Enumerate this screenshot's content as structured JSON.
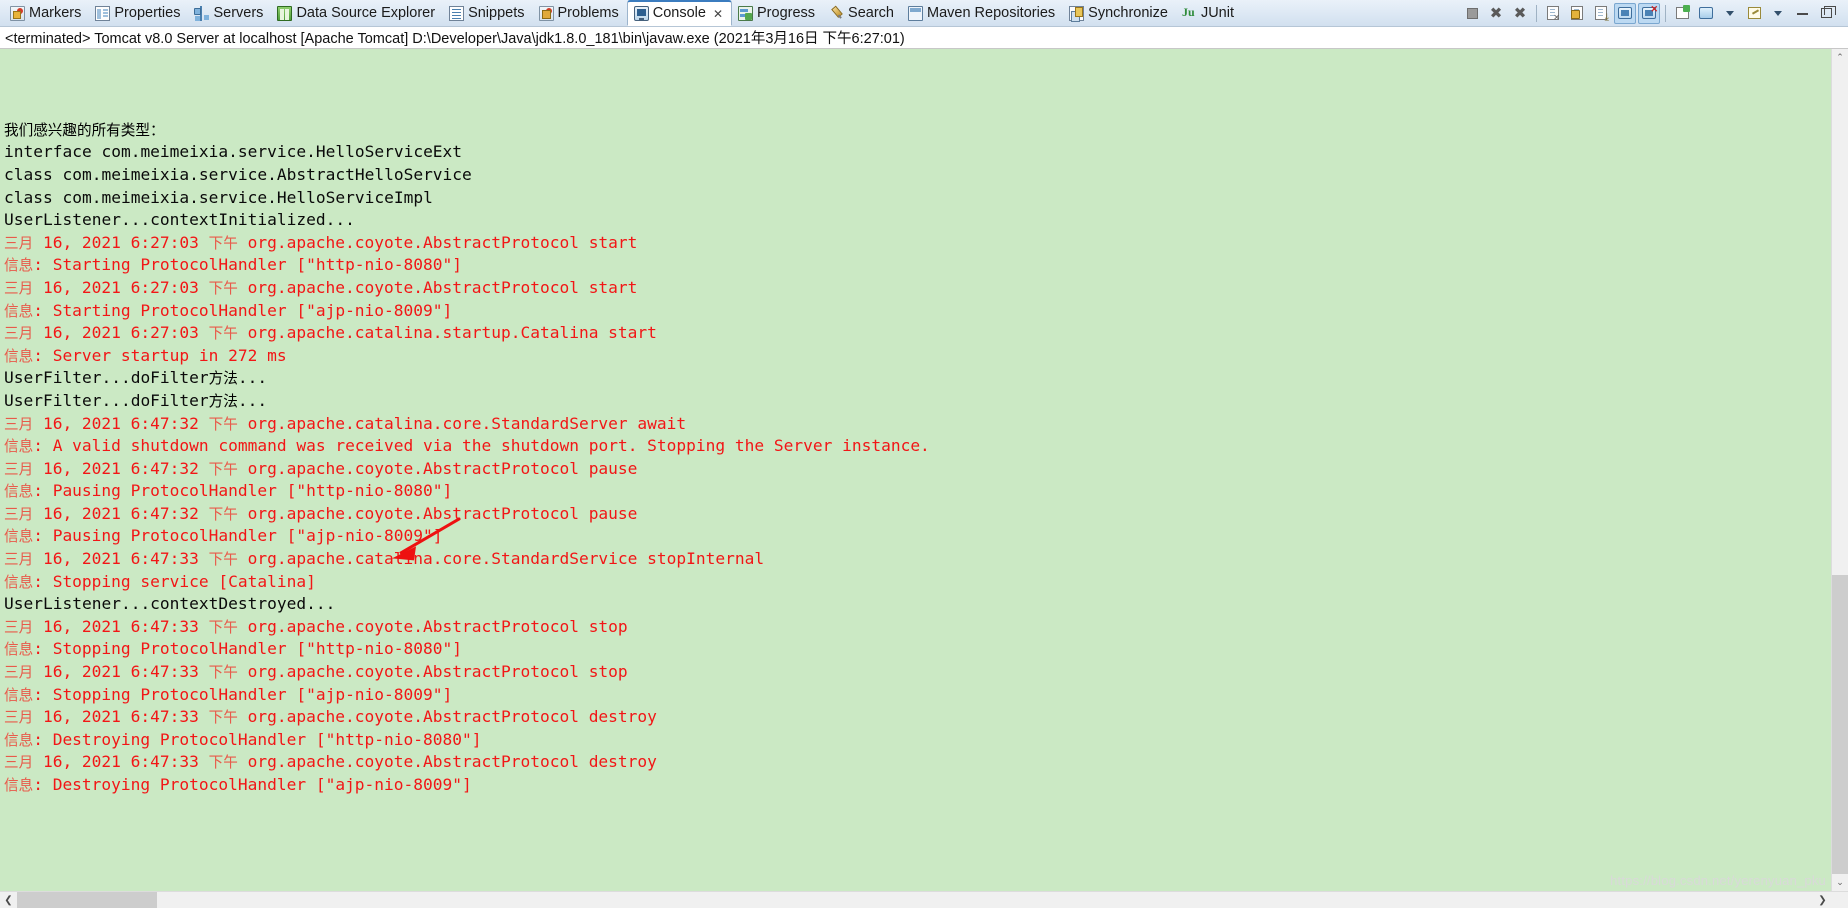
{
  "tabbar": {
    "tabs": [
      {
        "label": "Markers",
        "icon": "markers-icon",
        "active": false
      },
      {
        "label": "Properties",
        "icon": "properties-icon",
        "active": false
      },
      {
        "label": "Servers",
        "icon": "servers-icon",
        "active": false
      },
      {
        "label": "Data Source Explorer",
        "icon": "data-source-explorer-icon",
        "active": false
      },
      {
        "label": "Snippets",
        "icon": "snippets-icon",
        "active": false
      },
      {
        "label": "Problems",
        "icon": "problems-icon",
        "active": false
      },
      {
        "label": "Console",
        "icon": "console-icon",
        "active": true,
        "close": "✕"
      },
      {
        "label": "Progress",
        "icon": "progress-icon",
        "active": false
      },
      {
        "label": "Search",
        "icon": "search-icon",
        "active": false
      },
      {
        "label": "Maven Repositories",
        "icon": "maven-repositories-icon",
        "active": false
      },
      {
        "label": "Synchronize",
        "icon": "synchronize-icon",
        "active": false
      },
      {
        "label": "JUnit",
        "icon": "junit-icon",
        "active": false
      }
    ],
    "toolbar": [
      {
        "name": "terminate-button",
        "tooltip": "Terminate",
        "pressed": false
      },
      {
        "name": "remove-launch-button",
        "tooltip": "Remove Launch",
        "pressed": false
      },
      {
        "name": "remove-all-terminated-button",
        "tooltip": "Remove All Terminated Launches",
        "pressed": false
      },
      {
        "name": "clear-console-button",
        "tooltip": "Clear Console",
        "pressed": false
      },
      {
        "name": "scroll-lock-button",
        "tooltip": "Scroll Lock",
        "pressed": false
      },
      {
        "name": "word-wrap-button",
        "tooltip": "Word Wrap",
        "pressed": false
      },
      {
        "name": "show-console-on-output-button",
        "tooltip": "Show Console When Standard Out Changes",
        "pressed": true
      },
      {
        "name": "show-console-on-error-button",
        "tooltip": "Show Console When Standard Error Changes",
        "pressed": true
      },
      {
        "name": "pin-console-button",
        "tooltip": "Pin Console",
        "pressed": false
      },
      {
        "name": "display-selected-console-button",
        "tooltip": "Display Selected Console",
        "pressed": false
      },
      {
        "name": "display-console-dropdown",
        "tooltip": "Display Selected Console Menu",
        "pressed": false
      },
      {
        "name": "open-console-button",
        "tooltip": "Open Console",
        "pressed": false
      },
      {
        "name": "open-console-dropdown",
        "tooltip": "Open Console Menu",
        "pressed": false
      },
      {
        "name": "minimize-button",
        "tooltip": "Minimize",
        "pressed": false
      },
      {
        "name": "maximize-button",
        "tooltip": "Maximize",
        "pressed": false
      }
    ]
  },
  "console": {
    "title": "<terminated> Tomcat v8.0 Server at localhost [Apache Tomcat] D:\\Developer\\Java\\jdk1.8.0_181\\bin\\javaw.exe (2021年3月16日 下午6:27:01)",
    "background_color": "#cbe9c4",
    "stdout_color": "#0a0a0a",
    "stderr_color": "#f21616",
    "lines": [
      {
        "stream": "out",
        "text": "我们感兴趣的所有类型："
      },
      {
        "stream": "out",
        "text": "interface com.meimeixia.service.HelloServiceExt"
      },
      {
        "stream": "out",
        "text": "class com.meimeixia.service.AbstractHelloService"
      },
      {
        "stream": "out",
        "text": "class com.meimeixia.service.HelloServiceImpl"
      },
      {
        "stream": "out",
        "text": "UserListener...contextInitialized..."
      },
      {
        "stream": "err",
        "text": "三月 16, 2021 6:27:03 下午 org.apache.coyote.AbstractProtocol start"
      },
      {
        "stream": "err",
        "text": "信息: Starting ProtocolHandler [\"http-nio-8080\"]"
      },
      {
        "stream": "err",
        "text": "三月 16, 2021 6:27:03 下午 org.apache.coyote.AbstractProtocol start"
      },
      {
        "stream": "err",
        "text": "信息: Starting ProtocolHandler [\"ajp-nio-8009\"]"
      },
      {
        "stream": "err",
        "text": "三月 16, 2021 6:27:03 下午 org.apache.catalina.startup.Catalina start"
      },
      {
        "stream": "err",
        "text": "信息: Server startup in 272 ms"
      },
      {
        "stream": "out",
        "text": "UserFilter...doFilter方法..."
      },
      {
        "stream": "out",
        "text": "UserFilter...doFilter方法..."
      },
      {
        "stream": "err",
        "text": "三月 16, 2021 6:47:32 下午 org.apache.catalina.core.StandardServer await"
      },
      {
        "stream": "err",
        "text": "信息: A valid shutdown command was received via the shutdown port. Stopping the Server instance."
      },
      {
        "stream": "err",
        "text": "三月 16, 2021 6:47:32 下午 org.apache.coyote.AbstractProtocol pause"
      },
      {
        "stream": "err",
        "text": "信息: Pausing ProtocolHandler [\"http-nio-8080\"]"
      },
      {
        "stream": "err",
        "text": "三月 16, 2021 6:47:32 下午 org.apache.coyote.AbstractProtocol pause"
      },
      {
        "stream": "err",
        "text": "信息: Pausing ProtocolHandler [\"ajp-nio-8009\"]"
      },
      {
        "stream": "err",
        "text": "三月 16, 2021 6:47:33 下午 org.apache.catalina.core.StandardService stopInternal"
      },
      {
        "stream": "err",
        "text": "信息: Stopping service [Catalina]"
      },
      {
        "stream": "out",
        "text": "UserListener...contextDestroyed..."
      },
      {
        "stream": "err",
        "text": "三月 16, 2021 6:47:33 下午 org.apache.coyote.AbstractProtocol stop"
      },
      {
        "stream": "err",
        "text": "信息: Stopping ProtocolHandler [\"http-nio-8080\"]"
      },
      {
        "stream": "err",
        "text": "三月 16, 2021 6:47:33 下午 org.apache.coyote.AbstractProtocol stop"
      },
      {
        "stream": "err",
        "text": "信息: Stopping ProtocolHandler [\"ajp-nio-8009\"]"
      },
      {
        "stream": "err",
        "text": "三月 16, 2021 6:47:33 下午 org.apache.coyote.AbstractProtocol destroy"
      },
      {
        "stream": "err",
        "text": "信息: Destroying ProtocolHandler [\"http-nio-8080\"]"
      },
      {
        "stream": "err",
        "text": "三月 16, 2021 6:47:33 下午 org.apache.coyote.AbstractProtocol destroy"
      },
      {
        "stream": "err",
        "text": "信息: Destroying ProtocolHandler [\"ajp-nio-8009\"]"
      }
    ]
  },
  "annotation": {
    "arrow_color": "#ee1111",
    "points_to_line_index": 21,
    "points_to_text": "UserListener...contextDestroyed..."
  },
  "scrollbars": {
    "vertical_up": "⌃",
    "vertical_down": "⌄",
    "horizontal_left": "❮",
    "horizontal_right": "❯"
  },
  "watermark": {
    "text": "https://blog.csdn.net/yerenyuan_pku"
  }
}
